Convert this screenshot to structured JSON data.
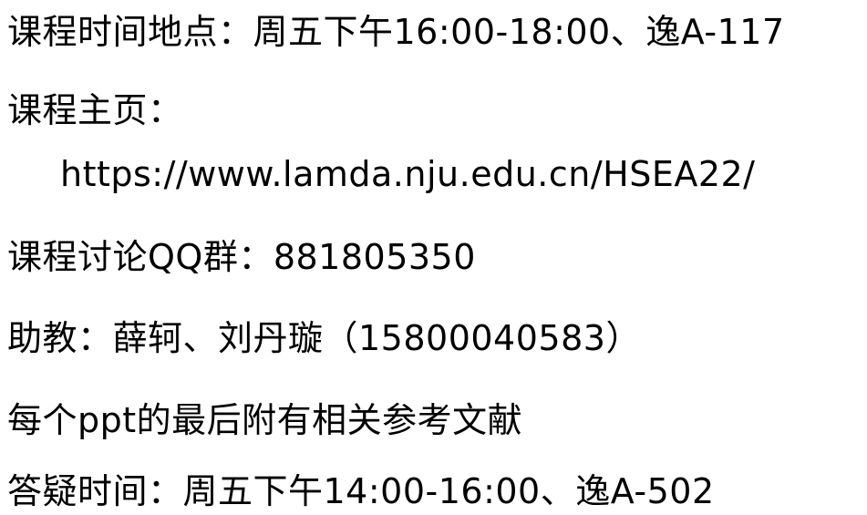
{
  "document": {
    "lines": [
      {
        "text": "课程时间地点：周五下午16:00-18:00、逸A-117"
      },
      {
        "text": "课程主页："
      },
      {
        "text": "https://www.lamda.nju.edu.cn/HSEA22/"
      },
      {
        "text": "课程讨论QQ群：881805350"
      },
      {
        "text": "助教：薛轲、刘丹璇（15800040583）"
      },
      {
        "text": "每个ppt的最后附有相关参考文献"
      },
      {
        "text": "答疑时间：周五下午14:00-16:00、逸A-502"
      }
    ]
  }
}
